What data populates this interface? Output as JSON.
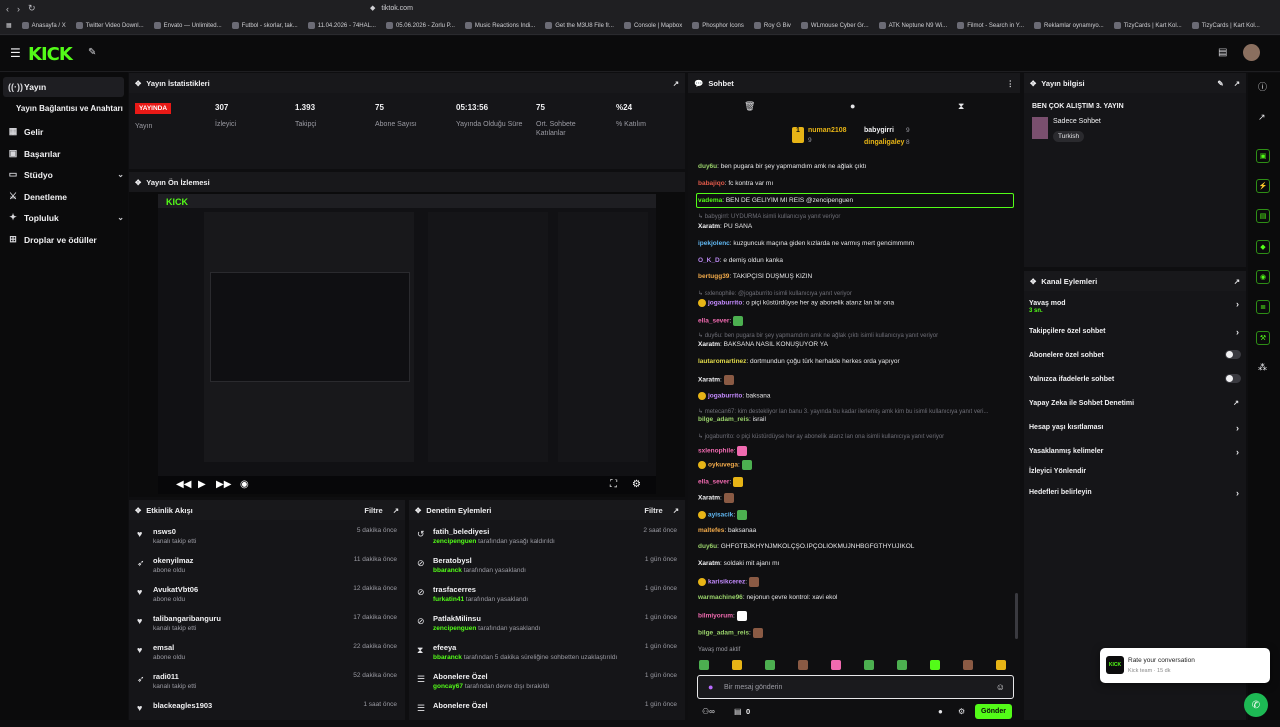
{
  "browser": {
    "url": "tiktok.com",
    "bookmarks": [
      "Anasayfa / X",
      "Twitter Video Downl...",
      "Envato — Unlimited...",
      "Futbol - skorlar, tak...",
      "11.04.2026 - 74HAL...",
      "05.06.2026 - Zorlu P...",
      "Music Reactions Indi...",
      "Get the M3U8 File fr...",
      "Console | Mapbox",
      "Phosphor Icons",
      "Roy G Biv",
      "WLmouse Cyber Gr...",
      "ATK Neptune N9 Wi...",
      "Filmot - Search in Y...",
      "Reklamlar oynamıyo...",
      "TizyCards | Kart Kol...",
      "TizyCards | Kart Kol..."
    ]
  },
  "header": {
    "logo": "KICK"
  },
  "sidebar": {
    "items": [
      {
        "label": "Yayın",
        "icon": "broadcast-icon"
      },
      {
        "label": "Yayın Bağlantısı ve Anahtarı",
        "icon": ""
      },
      {
        "label": "Gelir",
        "icon": "revenue-icon"
      },
      {
        "label": "Başarılar",
        "icon": "achievements-icon"
      },
      {
        "label": "Stüdyo",
        "icon": "studio-icon"
      },
      {
        "label": "Denetleme",
        "icon": "moderation-icon"
      },
      {
        "label": "Topluluk",
        "icon": "community-icon"
      },
      {
        "label": "Droplar ve ödüller",
        "icon": "drops-icon"
      }
    ]
  },
  "stats": {
    "title": "Yayın İstatistikleri",
    "live_badge": "YAYINDA",
    "live_label": "Yayın",
    "items": [
      {
        "value": "307",
        "label": "İzleyici"
      },
      {
        "value": "1.393",
        "label": "Takipçi"
      },
      {
        "value": "75",
        "label": "Abone Sayısı"
      },
      {
        "value": "05:13:56",
        "label": "Yayında Olduğu Süre"
      },
      {
        "value": "75",
        "label": "Ort. Sohbete Katılanlar"
      },
      {
        "value": "%24",
        "label": "% Katılım"
      }
    ]
  },
  "preview": {
    "title": "Yayın Ön İzlemesi"
  },
  "activity": {
    "title": "Etkinlik Akışı",
    "filter": "Filtre",
    "rows": [
      {
        "name": "nsws0",
        "sub": "kanalı takip etti",
        "time": "5 dakika önce"
      },
      {
        "name": "okenyilmaz",
        "sub": "abone oldu",
        "time": "11 dakika önce"
      },
      {
        "name": "AvukatVbt06",
        "sub": "abone oldu",
        "time": "12 dakika önce"
      },
      {
        "name": "talibangaribanguru",
        "sub": "kanalı takip etti",
        "time": "17 dakika önce"
      },
      {
        "name": "emsal",
        "sub": "abone oldu",
        "time": "22 dakika önce"
      },
      {
        "name": "radi011",
        "sub": "kanalı takip etti",
        "time": "52 dakika önce"
      },
      {
        "name": "blackeagles1903",
        "sub": "",
        "time": "1 saat önce"
      }
    ]
  },
  "modlog": {
    "title": "Denetim Eylemleri",
    "filter": "Filtre",
    "rows": [
      {
        "name": "fatih_belediyesi",
        "by": "zencipenguen",
        "sub": "tarafından yasağı kaldırıldı",
        "time": "2 saat önce"
      },
      {
        "name": "Beratobysl",
        "by": "bbaranck",
        "sub": "tarafından yasaklandı",
        "time": "1 gün önce"
      },
      {
        "name": "trasfacerres",
        "by": "furkatin41",
        "sub": "tarafından yasaklandı",
        "time": "1 gün önce"
      },
      {
        "name": "PatlakMilinsu",
        "by": "zencipenguen",
        "sub": "tarafından yasaklandı",
        "time": "1 gün önce"
      },
      {
        "name": "efeeya",
        "by": "bbaranck",
        "sub": "tarafından 5 dakika süreliğine sohbetten uzaklaştırıldı",
        "time": "1 gün önce"
      },
      {
        "name": "Abonelere Özel",
        "by": "goncay67",
        "sub": "tarafından devre dışı bırakıldı",
        "time": "1 gün önce"
      },
      {
        "name": "Abonelere Özel",
        "by": "",
        "sub": "",
        "time": "1 gün önce"
      }
    ]
  },
  "chat": {
    "title": "Sohbet",
    "top_gifters": [
      {
        "name": "numan2108",
        "count": "9"
      },
      {
        "name": "babygirri",
        "count": "9"
      },
      {
        "name": "dingaligaley",
        "count": "8"
      }
    ],
    "messages": [
      {
        "user": "duy6u",
        "text": "ben pugara bir şey yapmamdım amk ne ağlak çıktı",
        "color": "#9ad36b"
      },
      {
        "user": "babajiqo",
        "text": "fc kontra var mı",
        "color": "#e05a4a"
      },
      {
        "user": "vadema",
        "text": "BEN DE GELİYİM Mİ REİS @zencipenguen",
        "color": "#53fc18"
      },
      {
        "user": "",
        "text": "babygirrl: UYDURMA isimli kullanıcıya yanıt veriyor",
        "color": "",
        "reply": true
      },
      {
        "user": "Xaratm",
        "text": "PU SANA",
        "color": "#f1f1f3"
      },
      {
        "user": "ipekjolenc",
        "text": "kuzguncuk maçına giden kızlarda ne varmış mert gencimmmm",
        "color": "#60b6f0"
      },
      {
        "user": "O_K_D",
        "text": "e demiş oldun kanka",
        "color": "#b987f0"
      },
      {
        "user": "bertugg39",
        "text": "TAKİPÇİSİ DÜŞMÜŞ KIZIN",
        "color": "#f0a94a"
      },
      {
        "user": "",
        "text": "sxlenophile: @jogaburrito isimli kullanıcıya yanıt veriyor",
        "color": "",
        "reply": true
      },
      {
        "user": "jogaburrito",
        "text": "o piçi küstürdüyse her ay abonelik atarız lan bir ona",
        "color": "#c48bff"
      },
      {
        "user": "ella_sever",
        "text": "",
        "color": "#f06ab0"
      },
      {
        "user": "",
        "text": "duy6u: ben pugara bir şey yapmamdım amk ne ağlak çıktı isimli kullanıcıya yanıt veriyor",
        "color": "",
        "reply": true
      },
      {
        "user": "Xaratm",
        "text": "BAKSANA NASIL KONUŞUYOR YA",
        "color": "#f1f1f3"
      },
      {
        "user": "lautaromartinez",
        "text": "dortmundun çoğu türk herhalde herkes orda yapıyor",
        "color": "#e0d94a"
      },
      {
        "user": "Xaratm",
        "text": "",
        "color": "#f1f1f3"
      },
      {
        "user": "jogaburrito",
        "text": "baksana",
        "color": "#c48bff"
      },
      {
        "user": "",
        "text": "metecan67: kim destekliyor lan banu 3. yayında bu kadar ilerlemiş amk kim bu isimli kullanıcıya yanıt veri...",
        "color": "",
        "reply": true
      },
      {
        "user": "bilge_adam_reis",
        "text": "israil",
        "color": "#9ad36b"
      },
      {
        "user": "",
        "text": "jogaburrito: o piçi küstürdüyse her ay abonelik atarız lan ona isimli kullanıcıya yanıt veriyor",
        "color": "",
        "reply": true
      },
      {
        "user": "sxlenophile",
        "text": "",
        "color": "#f06ab0"
      },
      {
        "user": "oykuvega",
        "text": "",
        "color": "#f0a94a"
      },
      {
        "user": "ella_sever",
        "text": "",
        "color": "#f06ab0"
      },
      {
        "user": "Xaratm",
        "text": "",
        "color": "#f1f1f3"
      },
      {
        "user": "ayisacik",
        "text": "",
        "color": "#60b6f0"
      },
      {
        "user": "maltefes",
        "text": "baksanaa",
        "color": "#f0a94a"
      },
      {
        "user": "duy6u",
        "text": "GHFGTBJKHYNJMKÖLÇŞO.İPÇOLİÖKMUJNHBGFGTHYUJIKOL",
        "color": "#9ad36b"
      },
      {
        "user": "Xaratm",
        "text": "soldaki mit ajanı mı",
        "color": "#f1f1f3"
      },
      {
        "user": "karisikcerez",
        "text": "",
        "color": "#c48bff"
      },
      {
        "user": "warmachine96",
        "text": "nejonun çevre kontrol: xavi ekol",
        "color": "#9ad36b"
      },
      {
        "user": "bilmiyorum",
        "text": "",
        "color": "#f06ab0"
      },
      {
        "user": "bilge_adam_reis",
        "text": "",
        "color": "#9ad36b"
      }
    ],
    "slow_mode_label": "Yavaş mod aktif",
    "input_placeholder": "Bir mesaj gönderin",
    "viewer_count": "0",
    "send_label": "Gönder"
  },
  "stream_info": {
    "title": "Yayın bilgisi",
    "stream_title": "BEN ÇOK ALIŞTIM 3. YAYIN",
    "category": "Sadece Sohbet",
    "tag": "Turkish"
  },
  "channel_actions": {
    "title": "Kanal Eylemleri",
    "items": [
      {
        "label": "Yavaş mod",
        "sub": "3 sn.",
        "control": "chevron"
      },
      {
        "label": "Takipçilere özel sohbet",
        "sub": "",
        "control": "chevron"
      },
      {
        "label": "Abonelere özel sohbet",
        "sub": "",
        "control": "toggle"
      },
      {
        "label": "Yalnızca ifadelerle sohbet",
        "sub": "",
        "control": "toggle"
      },
      {
        "label": "Yapay Zeka ile Sohbet Denetimi",
        "sub": "",
        "control": "external"
      },
      {
        "label": "Hesap yaşı kısıtlaması",
        "sub": "",
        "control": "chevron"
      },
      {
        "label": "Yasaklanmış kelimeler",
        "sub": "",
        "control": "chevron"
      },
      {
        "label": "İzleyici Yönlendir",
        "sub": "",
        "control": "none"
      },
      {
        "label": "Hedefleri belirleyin",
        "sub": "",
        "control": "chevron"
      }
    ]
  },
  "toast": {
    "title": "Rate your conversation",
    "sub": "Kick team · 15 dk"
  }
}
